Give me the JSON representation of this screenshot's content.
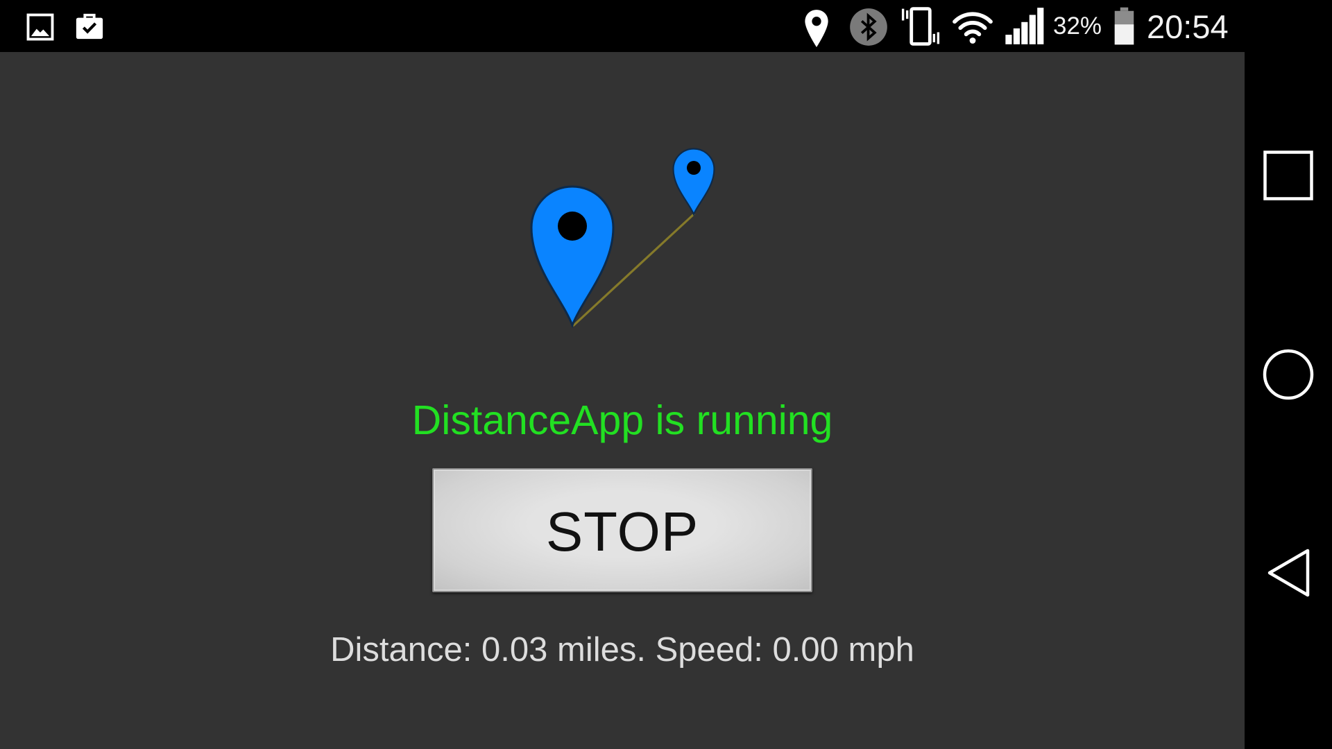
{
  "status_bar": {
    "notification_icons": [
      "gallery-icon",
      "briefcase-check-icon"
    ],
    "system_icons": [
      "location-icon",
      "bluetooth-icon",
      "vibrate-icon",
      "wifi-icon",
      "signal-icon",
      "battery-icon"
    ],
    "battery_percent": "32%",
    "time": "20:54"
  },
  "app": {
    "logo_icon": "distance-pins-logo-icon",
    "status_text": "DistanceApp is running",
    "stop_button_label": "STOP",
    "stats": {
      "distance_label": "Distance:",
      "distance_value": "0.03",
      "distance_unit": "miles.",
      "speed_label": "Speed:",
      "speed_value": "0.00",
      "speed_unit": "mph"
    }
  },
  "nav_bar": {
    "buttons": [
      "recent-apps-icon",
      "home-icon",
      "back-icon"
    ]
  },
  "colors": {
    "status_text": "#22e022",
    "pin_blue": "#0a84ff",
    "pin_outline": "#0d2a4a",
    "route_line": "#857a2a",
    "content_bg": "#333333",
    "system_bars": "#000000",
    "stats_text": "#dddddd"
  }
}
